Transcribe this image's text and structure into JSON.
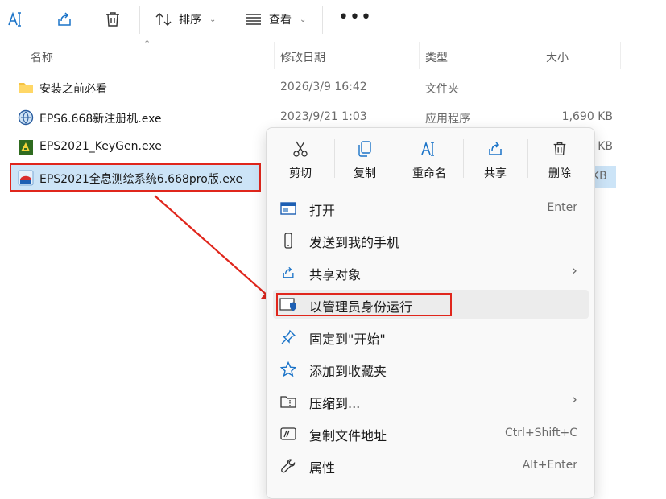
{
  "toolbar": {
    "sort_label": "排序",
    "view_label": "查看",
    "more_label": "•••"
  },
  "columns": {
    "name": "名称",
    "modified": "修改日期",
    "type": "类型",
    "size": "大小"
  },
  "files": [
    {
      "name": "安装之前必看",
      "date": "2026/3/9 16:42",
      "type": "文件夹",
      "size": "",
      "icon": "folder-icon"
    },
    {
      "name": "EPS6.668新注册机.exe",
      "date": "2023/9/21 1:03",
      "type": "应用程序",
      "size": "1,690 KB",
      "icon": "keygen-app-icon"
    },
    {
      "name": "EPS2021_KeyGen.exe",
      "date": "",
      "type": "",
      "size": "KB",
      "icon": "keygen-app-icon"
    },
    {
      "name": "EPS2021全息测绘系统6.668pro版.exe",
      "date": "",
      "type": "",
      "size": "KB",
      "icon": "eps-app-icon"
    }
  ],
  "context_menu": {
    "quick_actions": [
      {
        "label": "剪切",
        "icon": "scissors-icon"
      },
      {
        "label": "复制",
        "icon": "copy-icon"
      },
      {
        "label": "重命名",
        "icon": "rename-icon"
      },
      {
        "label": "共享",
        "icon": "share-icon"
      },
      {
        "label": "删除",
        "icon": "trash-icon"
      }
    ],
    "items": [
      {
        "label": "打开",
        "shortcut": "Enter",
        "icon": "app-window-icon"
      },
      {
        "label": "发送到我的手机",
        "shortcut": "",
        "icon": "phone-icon"
      },
      {
        "label": "共享对象",
        "shortcut": "",
        "icon": "share-icon",
        "submenu": "›"
      },
      {
        "label": "以管理员身份运行",
        "shortcut": "",
        "icon": "admin-shield-icon"
      },
      {
        "label": "固定到\"开始\"",
        "shortcut": "",
        "icon": "pin-icon"
      },
      {
        "label": "添加到收藏夹",
        "shortcut": "",
        "icon": "star-icon"
      },
      {
        "label": "压缩到...",
        "shortcut": "",
        "icon": "zip-folder-icon",
        "submenu": "›"
      },
      {
        "label": "复制文件地址",
        "shortcut": "Ctrl+Shift+C",
        "icon": "copy-path-icon"
      },
      {
        "label": "属性",
        "shortcut": "Alt+Enter",
        "icon": "wrench-icon"
      }
    ]
  },
  "colors": {
    "selection": "#cce4f7",
    "annotation_red": "#e0261c",
    "accent_blue": "#1a73c8"
  }
}
